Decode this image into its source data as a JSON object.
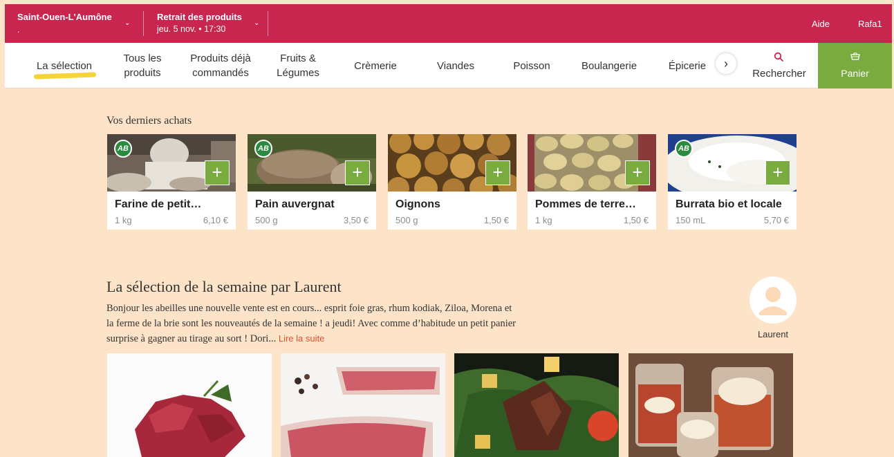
{
  "topbar": {
    "location": "Saint-Ouen-L'Aumône",
    "location_sub": ".",
    "retrait_title": "Retrait des produits",
    "retrait_date": "jeu. 5 nov. • 17:30",
    "help": "Aide",
    "user": "Rafa1",
    "color": "#c8264f"
  },
  "nav": {
    "items": [
      {
        "line1": "La sélection",
        "line2": ""
      },
      {
        "line1": "Tous les",
        "line2": "produits"
      },
      {
        "line1": "Produits déjà",
        "line2": "commandés"
      },
      {
        "line1": "Fruits &",
        "line2": "Légumes"
      },
      {
        "line1": "Crèmerie",
        "line2": ""
      },
      {
        "line1": "Viandes",
        "line2": ""
      },
      {
        "line1": "Poisson",
        "line2": ""
      },
      {
        "line1": "Boulangerie",
        "line2": ""
      },
      {
        "line1": "Épicerie",
        "line2": ""
      }
    ],
    "search": "Rechercher",
    "cart": "Panier",
    "cart_color": "#7aab3f"
  },
  "recent": {
    "title": "Vos derniers achats",
    "products": [
      {
        "name": "Farine de petit…",
        "qty": "1 kg",
        "price": "6,10 €",
        "organic": true
      },
      {
        "name": "Pain auvergnat",
        "qty": "500 g",
        "price": "3,50 €",
        "organic": true
      },
      {
        "name": "Oignons",
        "qty": "500 g",
        "price": "1,50 €",
        "organic": false
      },
      {
        "name": "Pommes de terre…",
        "qty": "1 kg",
        "price": "1,50 €",
        "organic": false
      },
      {
        "name": "Burrata bio et locale",
        "qty": "150 mL",
        "price": "5,70 €",
        "organic": true
      }
    ],
    "organic_label": "AB",
    "add_symbol": "+"
  },
  "selection": {
    "title": "La sélection de la semaine par Laurent",
    "text": "Bonjour les abeilles une nouvelle vente est en cours... esprit foie gras, rhum kodiak, Ziloa, Morena et la ferme de la brie sont les nouveautés de la semaine ! a jeudi! Avec comme d’habitude un petit panier surprise à gagner au tirage au sort ! Dori...",
    "read_more": "Lire la suite",
    "author": "Laurent"
  }
}
